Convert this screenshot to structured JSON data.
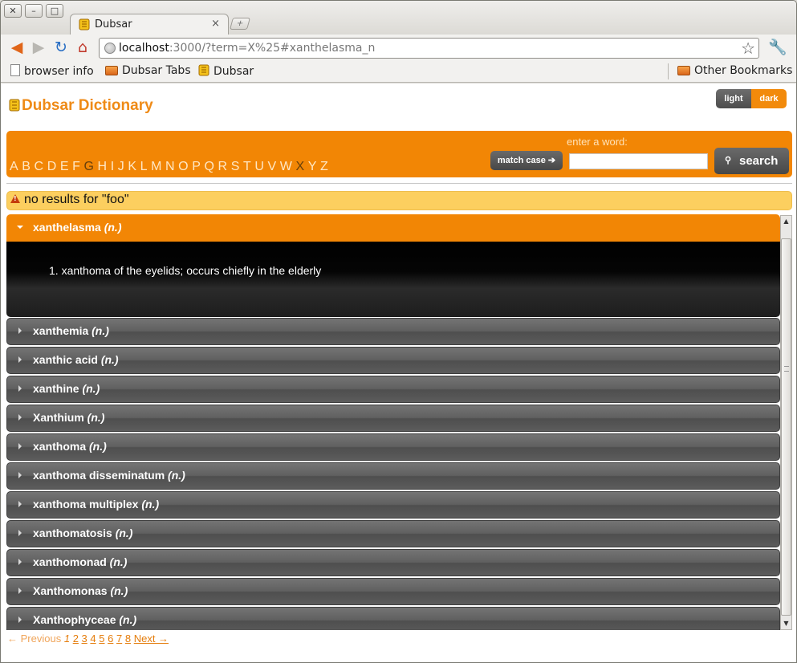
{
  "browser": {
    "tab_title": "Dubsar",
    "tab_close": "×",
    "newtab_icon": "+",
    "url_host": "localhost",
    "url_rest": ":3000/?term=X%25#xanthelasma_n",
    "bookmarks": [
      {
        "label": "browser info",
        "icon": "page-icon"
      },
      {
        "label": "Dubsar Tabs",
        "icon": "folder-icon"
      },
      {
        "label": "Dubsar",
        "icon": "dubsar-logo-icon"
      }
    ],
    "other_bookmarks": "Other Bookmarks",
    "window_buttons": [
      "✕",
      "–",
      "□"
    ]
  },
  "header": {
    "brand": "Dubsar Dictionary",
    "theme_light": "light",
    "theme_dark": "dark"
  },
  "searchbar": {
    "letters": [
      "A",
      "B",
      "C",
      "D",
      "E",
      "F",
      "G",
      "H",
      "I",
      "J",
      "K",
      "L",
      "M",
      "N",
      "O",
      "P",
      "Q",
      "R",
      "S",
      "T",
      "U",
      "V",
      "W",
      "X",
      "Y",
      "Z"
    ],
    "visited_letters": [
      "G",
      "X"
    ],
    "enter_label": "enter a word:",
    "match_case": "match case ➔",
    "search_value": "",
    "search_button": "search",
    "search_icon": "⚲"
  },
  "notice": {
    "message": "no results for \"foo\""
  },
  "results": {
    "open_entry": {
      "term": "xanthelasma",
      "pos": "(n.)",
      "definition": "1.  xanthoma of the eyelids; occurs chiefly in the elderly"
    },
    "entries": [
      {
        "term": "xanthemia",
        "pos": "(n.)"
      },
      {
        "term": "xanthic acid",
        "pos": "(n.)"
      },
      {
        "term": "xanthine",
        "pos": "(n.)"
      },
      {
        "term": "Xanthium",
        "pos": "(n.)"
      },
      {
        "term": "xanthoma",
        "pos": "(n.)"
      },
      {
        "term": "xanthoma disseminatum",
        "pos": "(n.)"
      },
      {
        "term": "xanthoma multiplex",
        "pos": "(n.)"
      },
      {
        "term": "xanthomatosis",
        "pos": "(n.)"
      },
      {
        "term": "xanthomonad",
        "pos": "(n.)"
      },
      {
        "term": "Xanthomonas",
        "pos": "(n.)"
      },
      {
        "term": "Xanthophyceae",
        "pos": "(n.)"
      }
    ]
  },
  "pager": {
    "prev": "← Previous",
    "current": "1",
    "pages": [
      "2",
      "3",
      "4",
      "5",
      "6",
      "7",
      "8"
    ],
    "next": "Next →"
  },
  "colors": {
    "accent": "#f28605",
    "brand": "#ef8b17",
    "notice": "#fccf5f"
  }
}
